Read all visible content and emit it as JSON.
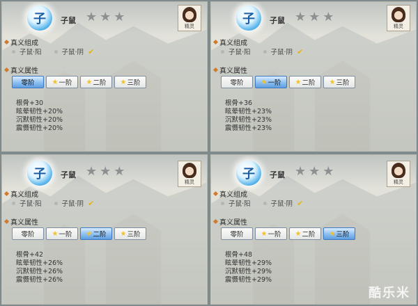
{
  "panels": [
    {
      "emblem_glyph": "子",
      "name": "子鼠",
      "stars": [
        "★",
        "★",
        "★"
      ],
      "avatar_label": "精灵",
      "composition_title": "真义组成",
      "composition": [
        "子鼠·阳",
        "子鼠·阴"
      ],
      "check": "✔",
      "attributes_title": "真义属性",
      "tabs": [
        "零阶",
        "一阶",
        "二阶",
        "三阶"
      ],
      "active_tab": 0,
      "attrs": [
        "根骨+30",
        "眩晕韧性+20%",
        "沉默韧性+20%",
        "震慑韧性+20%"
      ]
    },
    {
      "emblem_glyph": "子",
      "name": "子鼠",
      "stars": [
        "★",
        "★",
        "★"
      ],
      "avatar_label": "精灵",
      "composition_title": "真义组成",
      "composition": [
        "子鼠·阳",
        "子鼠·阴"
      ],
      "check": "✔",
      "attributes_title": "真义属性",
      "tabs": [
        "零阶",
        "一阶",
        "二阶",
        "三阶"
      ],
      "active_tab": 1,
      "attrs": [
        "根骨+36",
        "眩晕韧性+23%",
        "沉默韧性+23%",
        "震慑韧性+23%"
      ]
    },
    {
      "emblem_glyph": "子",
      "name": "子鼠",
      "stars": [
        "★",
        "★",
        "★"
      ],
      "avatar_label": "精灵",
      "composition_title": "真义组成",
      "composition": [
        "子鼠·阳",
        "子鼠·阴"
      ],
      "check": "✔",
      "attributes_title": "真义属性",
      "tabs": [
        "零阶",
        "一阶",
        "二阶",
        "三阶"
      ],
      "active_tab": 2,
      "attrs": [
        "根骨+42",
        "眩晕韧性+26%",
        "沉默韧性+26%",
        "震慑韧性+26%"
      ]
    },
    {
      "emblem_glyph": "子",
      "name": "子鼠",
      "stars": [
        "★",
        "★",
        "★"
      ],
      "avatar_label": "精灵",
      "composition_title": "真义组成",
      "composition": [
        "子鼠·阳",
        "子鼠·阴"
      ],
      "check": "✔",
      "attributes_title": "真义属性",
      "tabs": [
        "零阶",
        "一阶",
        "二阶",
        "三阶"
      ],
      "active_tab": 3,
      "attrs": [
        "根骨+48",
        "眩晕韧性+29%",
        "沉默韧性+29%",
        "震慑韧性+29%"
      ]
    }
  ],
  "colors": {
    "active_tab": "#8dbff0",
    "star_inactive": "#8d8f90",
    "star_tab": "#f2c22b",
    "check": "#e2b420"
  },
  "watermark": "酷乐米"
}
